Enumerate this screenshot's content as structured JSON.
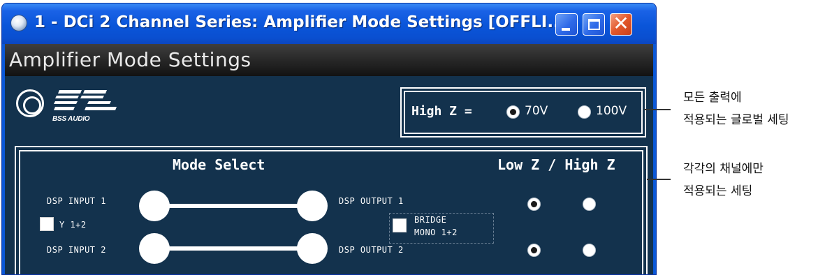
{
  "window": {
    "title": "1 - DCi 2 Channel Series: Amplifier Mode Settings [OFFLI...",
    "controls": {
      "minimize": "minimize",
      "maximize": "maximize",
      "close": "✕"
    }
  },
  "header": {
    "title": "Amplifier Mode Settings"
  },
  "logo": {
    "brand_text": "BSS AUDIO"
  },
  "high_z": {
    "label": "High Z =",
    "options": [
      {
        "label": "70V",
        "selected": true
      },
      {
        "label": "100V",
        "selected": false
      }
    ]
  },
  "mode_select": {
    "title": "Mode Select",
    "dsp_input_1": "DSP INPUT 1",
    "dsp_input_2": "DSP INPUT 2",
    "dsp_output_1": "DSP OUTPUT 1",
    "dsp_output_2": "DSP OUTPUT 2",
    "y_checkbox": {
      "label": "Y 1+2",
      "checked": false
    },
    "bridge_checkbox": {
      "label_line1": "BRIDGE",
      "label_line2": "MONO 1+2",
      "checked": false
    }
  },
  "low_high_z": {
    "title": "Low Z / High Z",
    "channels": [
      {
        "low_z_selected": true,
        "high_z_selected": false
      },
      {
        "low_z_selected": true,
        "high_z_selected": false
      }
    ]
  },
  "annotations": {
    "global": {
      "line1": "모든 출력에",
      "line2": "적용되는 글로벌 세팅"
    },
    "per_channel": {
      "line1": "각각의 채널에만",
      "line2": "적용되는 세팅"
    }
  },
  "colors": {
    "titlebar": "#0a55d9",
    "panel_bg": "#13324d",
    "header_bg": "#1e1e1e",
    "close_button": "#e3582a"
  }
}
